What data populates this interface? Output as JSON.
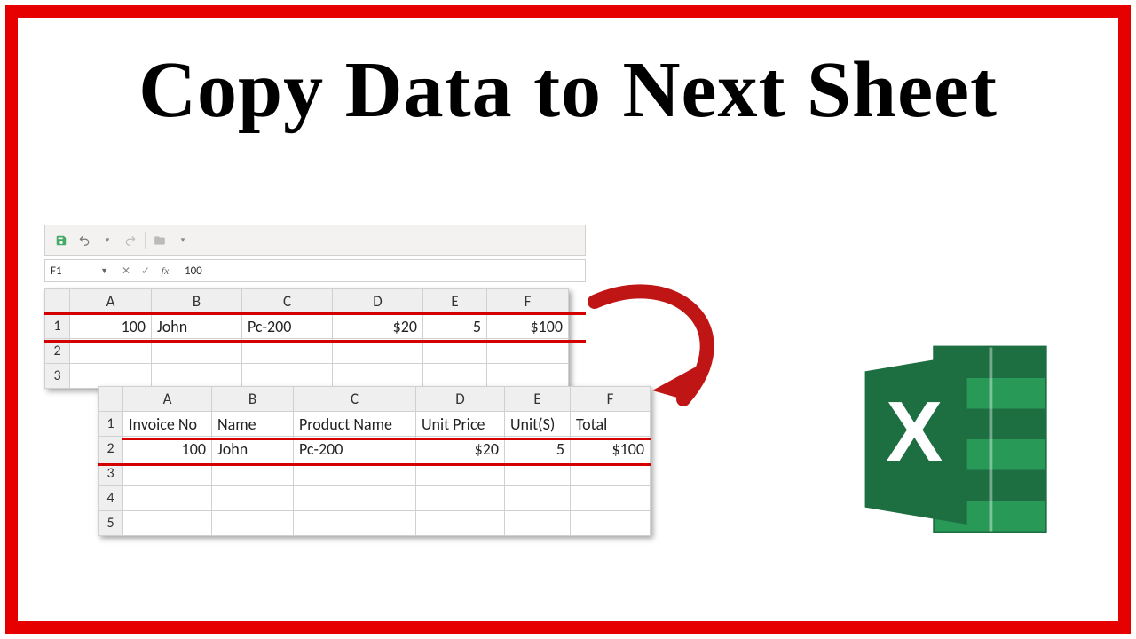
{
  "title": "Copy Data to Next Sheet",
  "quick_access": {
    "save_icon": "save",
    "undo_icon": "undo",
    "redo_icon": "redo"
  },
  "formula_bar": {
    "name_box": "F1",
    "cancel": "✕",
    "enter": "✓",
    "fx": "fx",
    "value": "100"
  },
  "sheet1": {
    "columns": [
      "A",
      "B",
      "C",
      "D",
      "E",
      "F"
    ],
    "rows": [
      "1",
      "2",
      "3"
    ],
    "r1": {
      "A": "100",
      "B": "John",
      "C": "Pc-200",
      "D": "$20",
      "E": "5",
      "F": "$100"
    }
  },
  "sheet2": {
    "columns": [
      "A",
      "B",
      "C",
      "D",
      "E",
      "F"
    ],
    "rows": [
      "1",
      "2",
      "3",
      "4",
      "5"
    ],
    "headers": {
      "A": "Invoice No",
      "B": "Name",
      "C": "Product Name",
      "D": "Unit Price",
      "E": "Unit(S)",
      "F": "Total"
    },
    "r2": {
      "A": "100",
      "B": "John",
      "C": "Pc-200",
      "D": "$20",
      "E": "5",
      "F": "$100"
    }
  },
  "logo": {
    "letter": "X"
  }
}
